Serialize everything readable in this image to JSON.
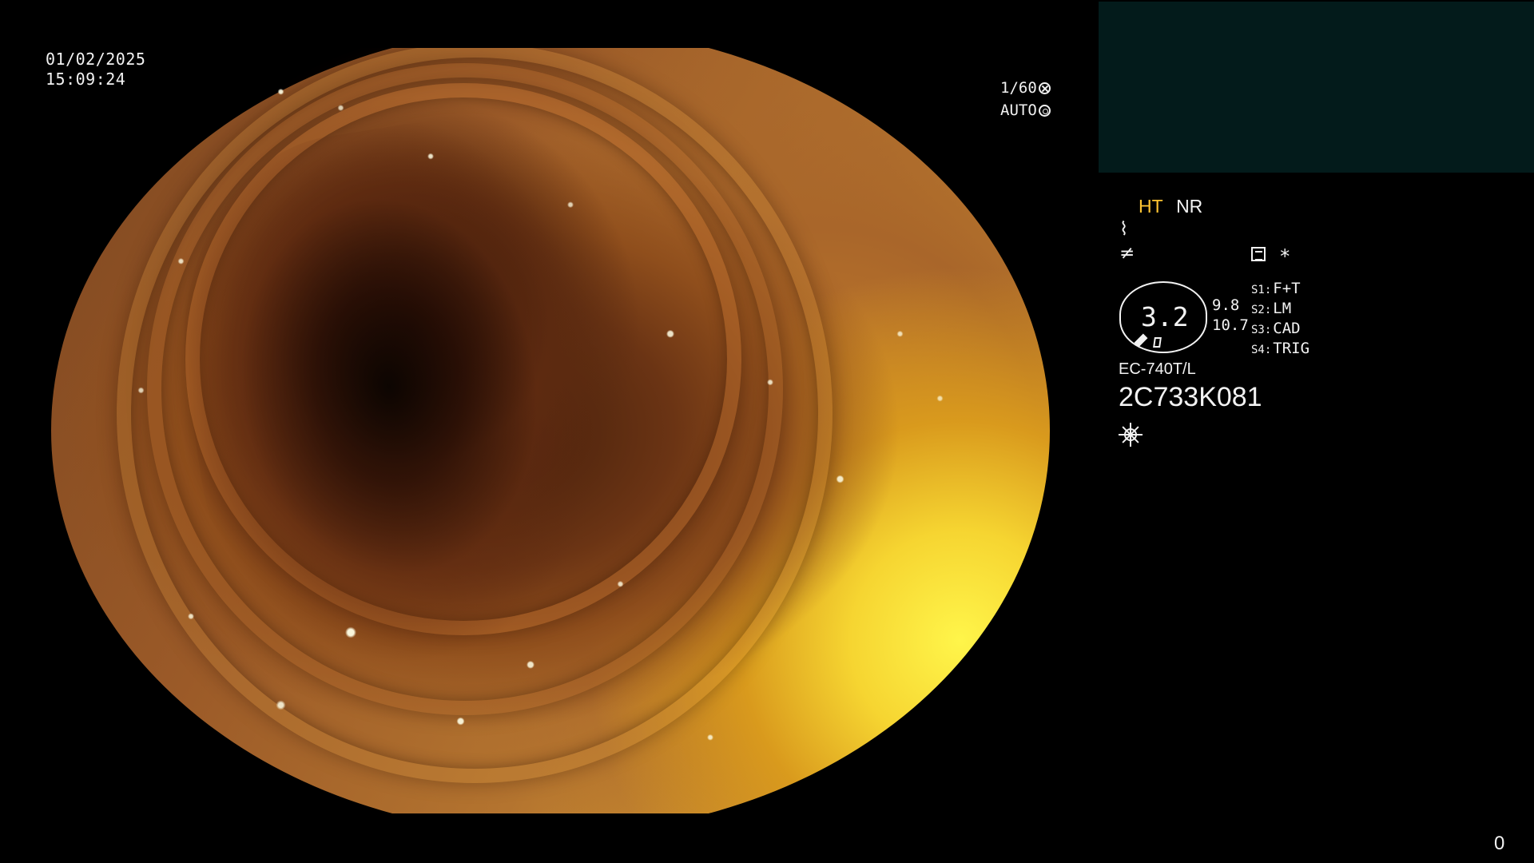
{
  "display": {
    "date": "01/02/2025",
    "time": "15:09:24",
    "shutter": "1/60",
    "exposure": "AUTO",
    "modes": {
      "ht": "HT",
      "nr": "NR",
      "ht_color": "#ffc432"
    },
    "symbols": {
      "asterisk": "*"
    },
    "gauge": {
      "value": "3.2",
      "upper": "9.8",
      "lower": "10.7"
    },
    "settings": [
      {
        "key": "S1:",
        "value": "F+T"
      },
      {
        "key": "S2:",
        "value": "LM"
      },
      {
        "key": "S3:",
        "value": "CAD"
      },
      {
        "key": "S4:",
        "value": "TRIG"
      }
    ],
    "model": "EC-740T/L",
    "serial": "2C733K081",
    "counter": "0"
  },
  "icons": {
    "aperture": "aperture-icon",
    "iris": "iris-icon",
    "memo": "memo-icon",
    "light": "light-icon",
    "scope_marker": "scope-marker-icon"
  },
  "colors": {
    "background": "#000000",
    "preview_box": "#031b1b",
    "text": "#f2f2f2",
    "accent": "#ffc432"
  }
}
